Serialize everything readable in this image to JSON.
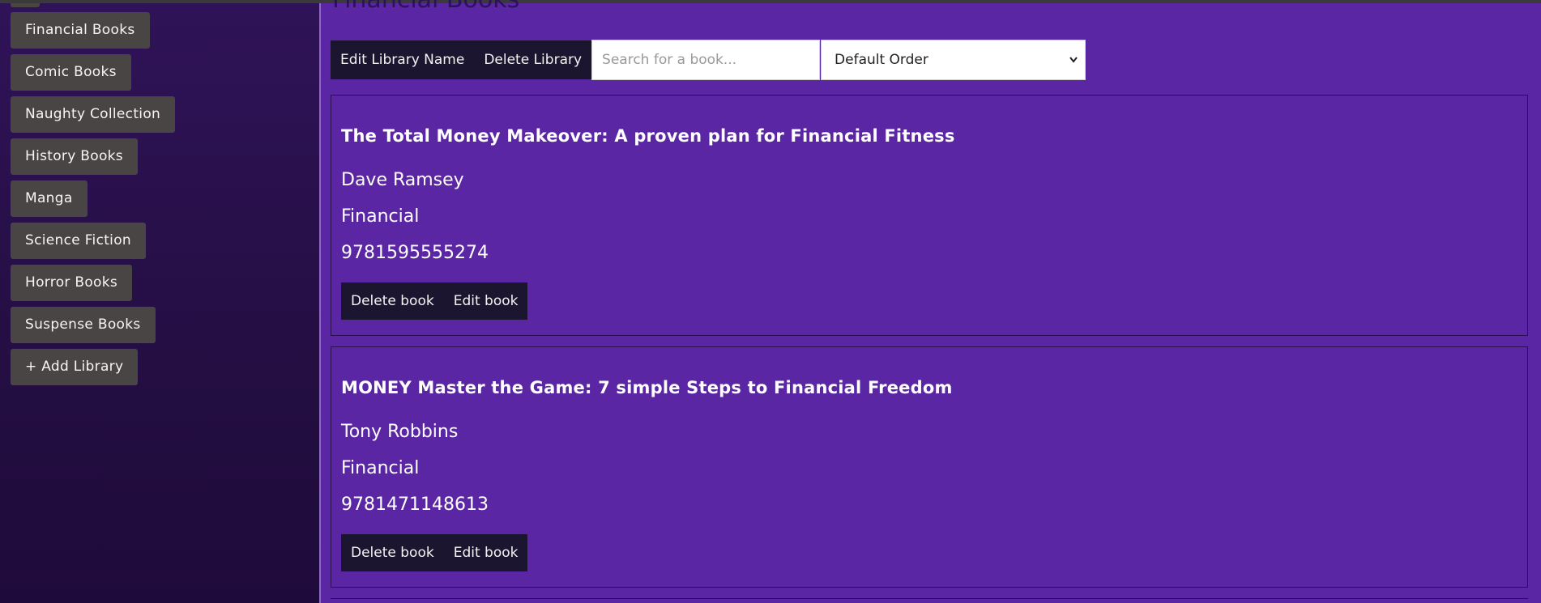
{
  "page_heading": "Financial Books",
  "sidebar": {
    "items": [
      {
        "label": "Financial Books"
      },
      {
        "label": "Comic Books"
      },
      {
        "label": "Naughty Collection"
      },
      {
        "label": "History Books"
      },
      {
        "label": "Manga"
      },
      {
        "label": "Science Fiction"
      },
      {
        "label": "Horror Books"
      },
      {
        "label": "Suspense Books"
      },
      {
        "label": "+ Add Library"
      }
    ]
  },
  "toolbar": {
    "edit_library_label": "Edit Library Name",
    "delete_library_label": "Delete Library",
    "search_placeholder": "Search for a book...",
    "order_selected": "Default Order"
  },
  "books": [
    {
      "title": "The Total Money Makeover: A proven plan for Financial Fitness",
      "author": "Dave Ramsey",
      "category": "Financial",
      "isbn": "9781595555274",
      "delete_label": "Delete book",
      "edit_label": "Edit book"
    },
    {
      "title": "MONEY Master the Game: 7 simple Steps to Financial Freedom",
      "author": "Tony Robbins",
      "category": "Financial",
      "isbn": "9781471148613",
      "delete_label": "Delete book",
      "edit_label": "Edit book"
    }
  ],
  "colors": {
    "main_bg": "#5b26a3",
    "sidebar_bg": "#2a1147",
    "button_bg": "#4a4545",
    "action_bg": "#1c1530"
  }
}
